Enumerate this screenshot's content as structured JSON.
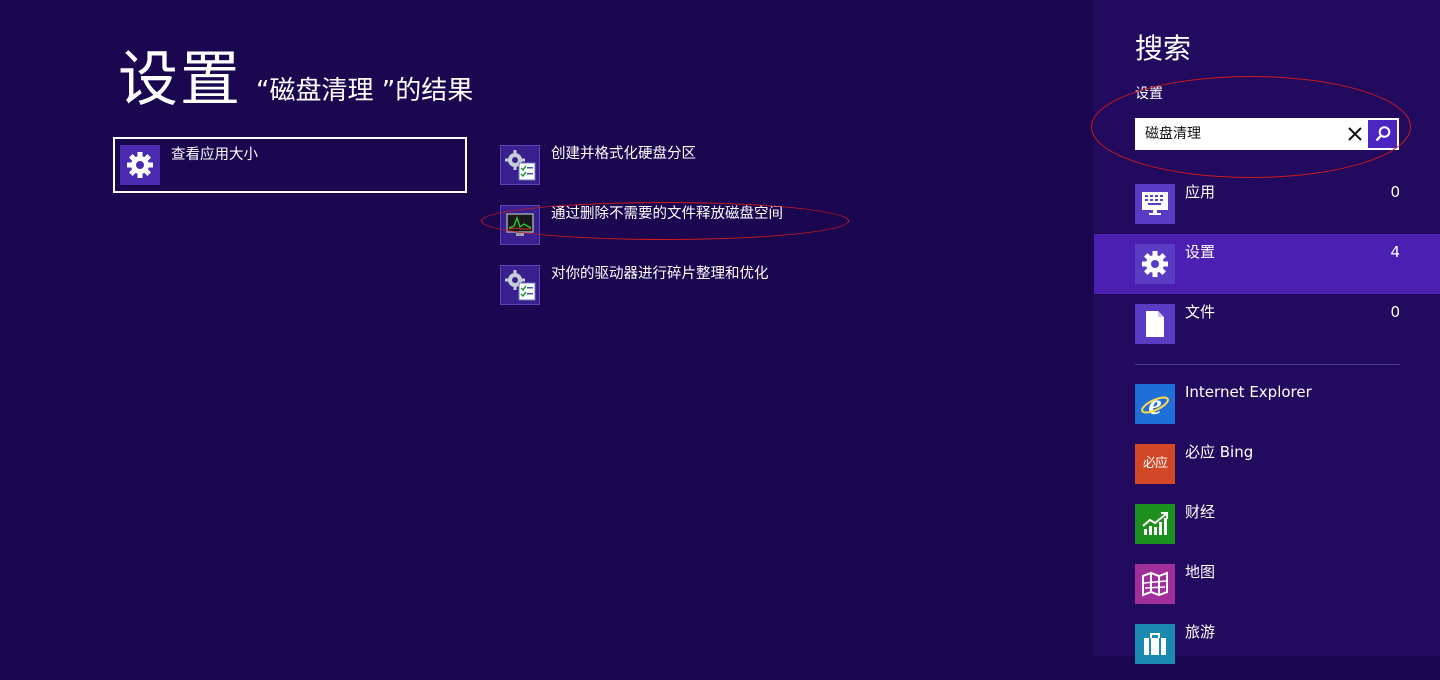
{
  "main": {
    "title": "设置",
    "subtitle": "“磁盘清理 ”的结果",
    "results": [
      {
        "label": "查看应用大小",
        "icon": "gear-icon"
      },
      {
        "label": "创建并格式化硬盘分区",
        "icon": "control-panel-gear-checklist-icon"
      },
      {
        "label": "通过删除不需要的文件释放磁盘空间",
        "icon": "disk-cleanup-monitor-icon"
      },
      {
        "label": "对你的驱动器进行碎片整理和优化",
        "icon": "control-panel-gear-checklist-icon"
      }
    ]
  },
  "search_pane": {
    "title": "搜索",
    "scope": "设置",
    "query": "磁盘清理",
    "categories": [
      {
        "label": "应用",
        "count": "0",
        "icon": "keyboard-monitor-icon"
      },
      {
        "label": "设置",
        "count": "4",
        "icon": "gear-icon",
        "active": true
      },
      {
        "label": "文件",
        "count": "0",
        "icon": "document-icon"
      }
    ],
    "apps": [
      {
        "label": "Internet Explorer",
        "icon": "internet-explorer-icon",
        "color": "#1e6fd6"
      },
      {
        "label": "必应 Bing",
        "icon": "bing-icon",
        "icon_text": "必应",
        "color": "#d24726"
      },
      {
        "label": "财经",
        "icon": "finance-chart-icon",
        "color": "#1c8f1c"
      },
      {
        "label": "地图",
        "icon": "map-icon",
        "color": "#a02f9c"
      },
      {
        "label": "旅游",
        "icon": "travel-suitcase-icon",
        "color": "#1a8ab0"
      }
    ]
  },
  "colors": {
    "background": "#1b0650",
    "pane_background": "#220a5e",
    "active_category": "#4b1fb2",
    "annotation": "#d11a1a"
  }
}
